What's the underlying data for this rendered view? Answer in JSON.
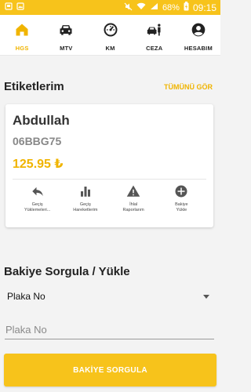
{
  "status_bar": {
    "battery": "68%",
    "time": "09:15"
  },
  "nav": {
    "items": [
      {
        "label": "HGS",
        "icon": "home-icon",
        "active": true
      },
      {
        "label": "MTV",
        "icon": "car-icon",
        "active": false
      },
      {
        "label": "KM",
        "icon": "speedometer-icon",
        "active": false
      },
      {
        "label": "CEZA",
        "icon": "police-car-icon",
        "active": false
      },
      {
        "label": "HESABIM",
        "icon": "account-icon",
        "active": false
      }
    ]
  },
  "tags_section": {
    "title": "Etiketlerim",
    "see_all": "TÜMÜNÜ GÖR"
  },
  "card": {
    "name": "Abdullah",
    "plate": "06BBG75",
    "balance": "125.95 ₺",
    "actions": [
      {
        "line1": "Geçiş",
        "line2": "Yüklemeleri...",
        "icon": "reply-arrow-icon"
      },
      {
        "line1": "Geçiş",
        "line2": "Hareketlerim",
        "icon": "bar-chart-icon"
      },
      {
        "line1": "İhlal",
        "line2": "Raporlarım",
        "icon": "warning-icon"
      },
      {
        "line1": "Bakiye",
        "line2": "Yükle",
        "icon": "add-circle-icon"
      }
    ]
  },
  "query_section": {
    "title": "Bakiye Sorgula / Yükle",
    "select_value": "Plaka No",
    "input_placeholder": "Plaka No",
    "input_value": "",
    "button_label": "BAKİYE SORGULA"
  },
  "colors": {
    "accent": "#f7c31b",
    "accent_text": "#f0b400"
  }
}
